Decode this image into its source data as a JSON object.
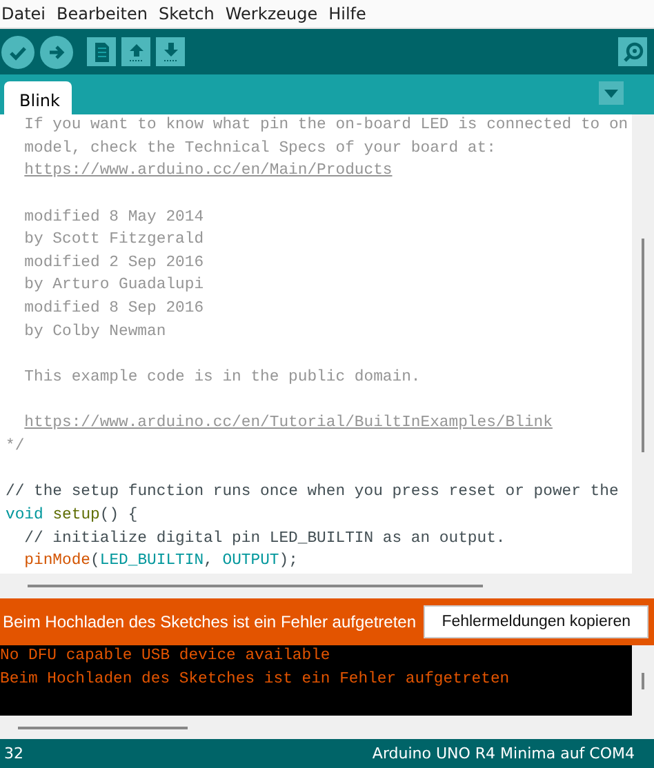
{
  "menu": [
    "Datei",
    "Bearbeiten",
    "Sketch",
    "Werkzeuge",
    "Hilfe"
  ],
  "tabs": [
    {
      "label": "Blink",
      "selected": true
    }
  ],
  "editor": {
    "lines": [
      {
        "kind": "code",
        "indent": true,
        "segments": [
          {
            "kind": "comment",
            "text": "If you want to know what pin the on-board LED is connected to on"
          }
        ]
      },
      {
        "kind": "code",
        "indent": true,
        "segments": [
          {
            "kind": "comment",
            "text": "model, check the Technical Specs of your board at:"
          }
        ]
      },
      {
        "kind": "code",
        "indent": true,
        "segments": [
          {
            "kind": "link",
            "text": "https://www.arduino.cc/en/Main/Products"
          }
        ]
      },
      {
        "kind": "blank"
      },
      {
        "kind": "code",
        "indent": true,
        "segments": [
          {
            "kind": "comment",
            "text": "modified 8 May 2014"
          }
        ]
      },
      {
        "kind": "code",
        "indent": true,
        "segments": [
          {
            "kind": "comment",
            "text": "by Scott Fitzgerald"
          }
        ]
      },
      {
        "kind": "code",
        "indent": true,
        "segments": [
          {
            "kind": "comment",
            "text": "modified 2 Sep 2016"
          }
        ]
      },
      {
        "kind": "code",
        "indent": true,
        "segments": [
          {
            "kind": "comment",
            "text": "by Arturo Guadalupi"
          }
        ]
      },
      {
        "kind": "code",
        "indent": true,
        "segments": [
          {
            "kind": "comment",
            "text": "modified 8 Sep 2016"
          }
        ]
      },
      {
        "kind": "code",
        "indent": true,
        "segments": [
          {
            "kind": "comment",
            "text": "by Colby Newman"
          }
        ]
      },
      {
        "kind": "blank"
      },
      {
        "kind": "code",
        "indent": true,
        "segments": [
          {
            "kind": "comment",
            "text": "This example code is in the public domain."
          }
        ]
      },
      {
        "kind": "blank"
      },
      {
        "kind": "code",
        "indent": true,
        "segments": [
          {
            "kind": "link",
            "text": "https://www.arduino.cc/en/Tutorial/BuiltInExamples/Blink"
          }
        ]
      },
      {
        "kind": "code",
        "indent": false,
        "segments": [
          {
            "kind": "comment",
            "text": "*/"
          }
        ]
      },
      {
        "kind": "blank"
      },
      {
        "kind": "code",
        "indent": false,
        "segments": [
          {
            "kind": "linecomment",
            "text": "// the setup function runs once when you press reset or power the"
          }
        ]
      },
      {
        "kind": "code",
        "indent": false,
        "segments": [
          {
            "kind": "keyword",
            "text": "void "
          },
          {
            "kind": "function",
            "text": "setup"
          },
          {
            "kind": "plain",
            "text": "() {"
          }
        ]
      },
      {
        "kind": "code",
        "indent": true,
        "segments": [
          {
            "kind": "linecomment",
            "text": "// initialize digital pin LED_BUILTIN as an output."
          }
        ]
      },
      {
        "kind": "code",
        "indent": true,
        "segments": [
          {
            "kind": "call",
            "text": "pinMode"
          },
          {
            "kind": "plain",
            "text": "("
          },
          {
            "kind": "constant",
            "text": "LED_BUILTIN"
          },
          {
            "kind": "plain",
            "text": ", "
          },
          {
            "kind": "constant",
            "text": "OUTPUT"
          },
          {
            "kind": "plain",
            "text": ");"
          }
        ]
      }
    ]
  },
  "notice": {
    "message": "Beim Hochladen des Sketches ist ein Fehler aufgetreten",
    "button": "Fehlermeldungen kopieren"
  },
  "console": {
    "lines": [
      "No DFU capable USB device available",
      "Beim Hochladen des Sketches ist ein Fehler aufgetreten"
    ]
  },
  "status_bar": {
    "line": "32",
    "board": "Arduino UNO R4 Minima auf COM4"
  }
}
